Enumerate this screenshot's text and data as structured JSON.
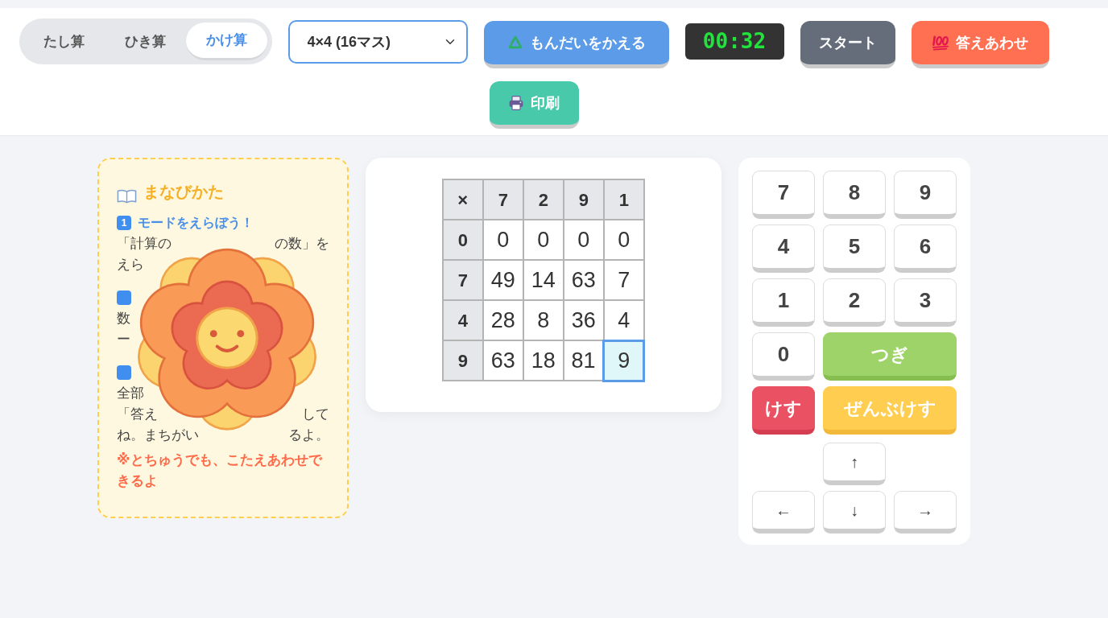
{
  "mode_tabs": [
    {
      "label": "たし算",
      "selected": false
    },
    {
      "label": "ひき算",
      "selected": false
    },
    {
      "label": "かけ算",
      "selected": true
    }
  ],
  "size_select": {
    "value": "4×4 (16マス)"
  },
  "toolbar": [
    {
      "kind": "shuffle",
      "label": "もんだいをかえる"
    },
    {
      "kind": "timer",
      "label": "00:32"
    },
    {
      "kind": "start",
      "label": "スタート"
    },
    {
      "kind": "check",
      "label": "答えあわせ"
    },
    {
      "kind": "print",
      "label": "印刷"
    }
  ],
  "guide": {
    "title": "まなびかた",
    "steps": [
      {
        "badge": "1",
        "heading": "モードをえらぼう！",
        "lines": [
          {
            "left": "「計算の",
            "right": "の数」を"
          },
          {
            "left": "えら"
          }
        ]
      },
      {
        "lines": [
          {
            "left": "数"
          },
          {
            "left": "ー"
          }
        ]
      },
      {
        "lines": [
          {
            "left": "全部"
          },
          {
            "left": "「答え",
            "right": "して"
          },
          {
            "left": "ね。まちがい",
            "right": "るよ。"
          }
        ]
      }
    ],
    "note": "※とちゅうでも、こたえあわせできるよ"
  },
  "grid": {
    "corner": "×",
    "columns": [
      "7",
      "2",
      "9",
      "1"
    ],
    "rows": [
      {
        "header": "0",
        "cells": [
          {
            "value": "0",
            "selected": false
          },
          {
            "value": "0",
            "selected": false
          },
          {
            "value": "0",
            "selected": false
          },
          {
            "value": "0",
            "selected": false
          }
        ]
      },
      {
        "header": "7",
        "cells": [
          {
            "value": "49",
            "selected": false
          },
          {
            "value": "14",
            "selected": false
          },
          {
            "value": "63",
            "selected": false
          },
          {
            "value": "7",
            "selected": false
          }
        ]
      },
      {
        "header": "4",
        "cells": [
          {
            "value": "28",
            "selected": false
          },
          {
            "value": "8",
            "selected": false
          },
          {
            "value": "36",
            "selected": false
          },
          {
            "value": "4",
            "selected": false
          }
        ]
      },
      {
        "header": "9",
        "cells": [
          {
            "value": "63",
            "selected": false
          },
          {
            "value": "18",
            "selected": false
          },
          {
            "value": "81",
            "selected": false
          },
          {
            "value": "9",
            "selected": true
          }
        ]
      }
    ]
  },
  "keypad": {
    "keys": [
      {
        "kind": "digit",
        "label": "7"
      },
      {
        "kind": "digit",
        "label": "8"
      },
      {
        "kind": "digit",
        "label": "9"
      },
      {
        "kind": "digit",
        "label": "4"
      },
      {
        "kind": "digit",
        "label": "5"
      },
      {
        "kind": "digit",
        "label": "6"
      },
      {
        "kind": "digit",
        "label": "1"
      },
      {
        "kind": "digit",
        "label": "2"
      },
      {
        "kind": "digit",
        "label": "3"
      },
      {
        "kind": "digit",
        "label": "0"
      },
      {
        "kind": "next",
        "label": "つぎ"
      },
      {
        "kind": "delete",
        "label": "けす"
      },
      {
        "kind": "clear",
        "label": "ぜんぶけす"
      }
    ],
    "arrows": [
      {
        "kind": "up",
        "label": "↑"
      },
      {
        "kind": "left",
        "label": "←"
      },
      {
        "kind": "down",
        "label": "↓"
      },
      {
        "kind": "right",
        "label": "→"
      }
    ]
  }
}
